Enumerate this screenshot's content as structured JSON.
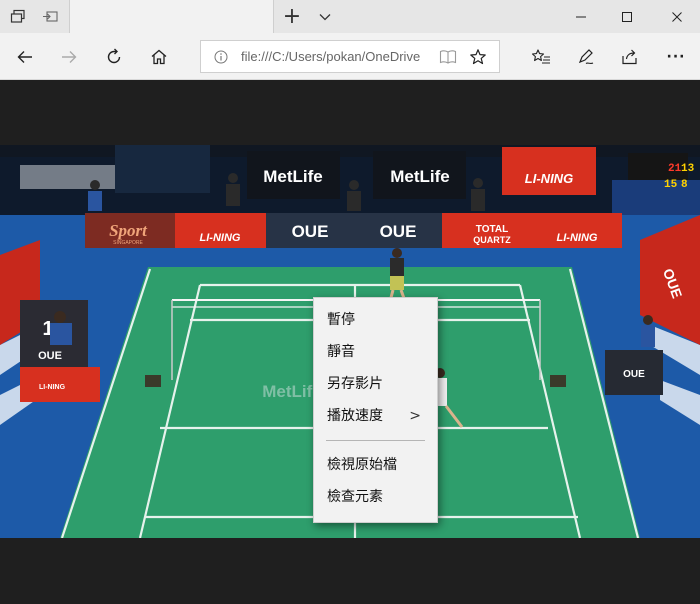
{
  "titlebar": {
    "new_tab_symbol": "+",
    "tab_list_symbol": "⌄",
    "minimize_symbol": "—",
    "close_symbol": "✕"
  },
  "navbar": {
    "url": "file:///C:/Users/pokan/OneDrive",
    "more_symbol": "···"
  },
  "video": {
    "ads": {
      "metlife": "MetLife",
      "lining": "LI-NING",
      "oue": "OUE",
      "sport": "Sport",
      "singapore": "SINGAPORE",
      "total": "TOTAL",
      "quartz": "QUARTZ"
    },
    "score_left": "1",
    "scoreboard": {
      "top": "21",
      "top2": "13",
      "bottom": "15",
      "bottom2": "8"
    }
  },
  "context_menu": {
    "items": [
      {
        "label": "暫停"
      },
      {
        "label": "靜音"
      },
      {
        "label": "另存影片"
      },
      {
        "label": "播放速度",
        "submenu_indicator": ">"
      },
      {
        "label": "檢視原始檔"
      },
      {
        "label": "檢查元素"
      }
    ]
  },
  "colors": {
    "court": "#2e9e6c",
    "floor": "#1d5aa8",
    "ad_red": "#d7301f",
    "ad_dark": "#1e2a3a"
  }
}
